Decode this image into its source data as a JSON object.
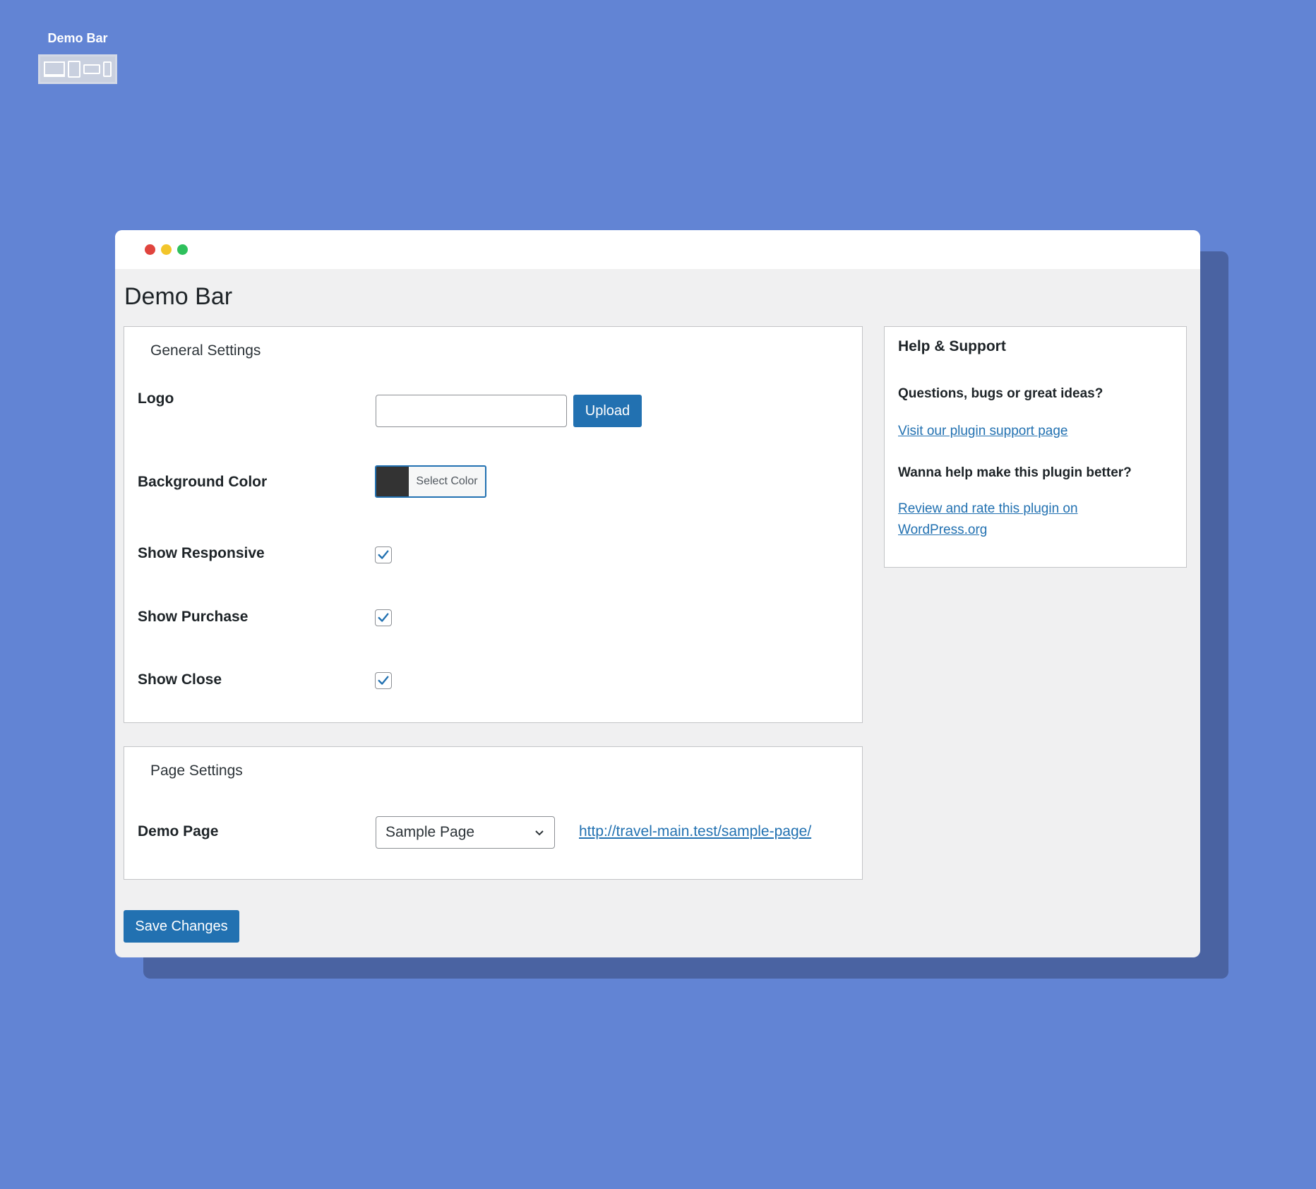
{
  "brand": {
    "title": "Demo Bar",
    "logo_icon": "responsive-devices-icon"
  },
  "window": {
    "controls": [
      "close",
      "minimize",
      "maximize"
    ],
    "page_title": "Demo Bar"
  },
  "general_settings": {
    "legend": "General Settings",
    "logo_label": "Logo",
    "logo_value": "",
    "upload_label": "Upload",
    "background_color_label": "Background Color",
    "background_color_value": "#333333",
    "select_color_label": "Select Color",
    "show_responsive_label": "Show Responsive",
    "show_purchase_label": "Show Purchase",
    "show_close_label": "Show Close",
    "show_responsive_checked": true,
    "show_purchase_checked": true,
    "show_close_checked": true
  },
  "page_settings": {
    "legend": "Page Settings",
    "demo_page_label": "Demo Page",
    "demo_page_value": "Sample Page",
    "demo_page_url": "http://travel-main.test/sample-page/"
  },
  "help": {
    "title": "Help & Support",
    "questions": "Questions, bugs or great ideas?",
    "support_link": "Visit our plugin support page",
    "improve": "Wanna help make this plugin better?",
    "review_link": "Review and rate this plugin on WordPress.org"
  },
  "actions": {
    "save_label": "Save Changes"
  },
  "colors": {
    "background": "#6284d4",
    "shadow": "#4a63a2",
    "accent": "#2271b1",
    "panel_bg": "#f0f0f1"
  }
}
